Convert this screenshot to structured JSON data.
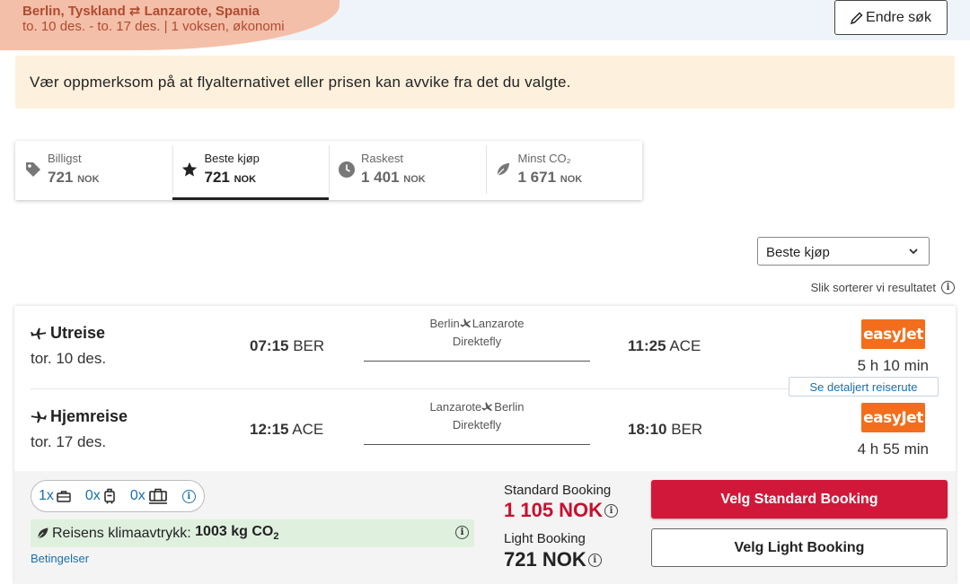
{
  "search": {
    "route": "Berlin, Tyskland ⇄ Lanzarote, Spania",
    "details": "to. 10 des. - to. 17 des.  |  1 voksen, økonomi",
    "edit_label": "Endre søk"
  },
  "warning": "Vær oppmerksom på at flyalternativet eller prisen kan avvike fra det du valgte.",
  "sort_tabs": [
    {
      "label": "Billigst",
      "price": "721",
      "currency": "NOK",
      "icon": "tag-icon",
      "active": false
    },
    {
      "label": "Beste kjøp",
      "price": "721",
      "currency": "NOK",
      "icon": "star-icon",
      "active": true
    },
    {
      "label": "Raskest",
      "price": "1 401",
      "currency": "NOK",
      "icon": "clock-icon",
      "active": false
    },
    {
      "label": "Minst CO₂",
      "price": "1 671",
      "currency": "NOK",
      "icon": "leaf-icon",
      "active": false
    }
  ],
  "sort_select": {
    "value": "Beste kjøp"
  },
  "sort_help": "Slik sorterer vi resultatet",
  "result": {
    "outbound": {
      "title": "Utreise",
      "date": "tor. 10 des.",
      "dep_time": "07:15",
      "dep_airport": "BER",
      "from": "Berlin",
      "to": "Lanzarote",
      "type": "Direktefly",
      "arr_time": "11:25",
      "arr_airport": "ACE",
      "airline": "easyJet",
      "duration": "5 h 10 min"
    },
    "details_link": "Se detaljert reiserute",
    "return": {
      "title": "Hjemreise",
      "date": "tor. 17 des.",
      "dep_time": "12:15",
      "dep_airport": "ACE",
      "from": "Lanzarote",
      "to": "Berlin",
      "type": "Direktefly",
      "arr_time": "18:10",
      "arr_airport": "BER",
      "airline": "easyJet",
      "duration": "4 h 55 min"
    },
    "baggage": {
      "personal": "1x",
      "cabin": "0x",
      "checked": "0x"
    },
    "climate": {
      "label": "Reisens klimaavtrykk:",
      "value": "1003 kg CO",
      "sub": "2"
    },
    "conditions": "Betingelser",
    "standard": {
      "label": "Standard Booking",
      "price": "1 105 NOK",
      "button": "Velg Standard Booking"
    },
    "light": {
      "label": "Light Booking",
      "price": "721 NOK",
      "button": "Velg Light Booking"
    }
  },
  "colors": {
    "accent_red": "#d2183a",
    "easyjet": "#f26e1c",
    "link": "#1a6fb0",
    "warning_bg": "#fdf0dd",
    "climate_bg": "#dff0df"
  }
}
